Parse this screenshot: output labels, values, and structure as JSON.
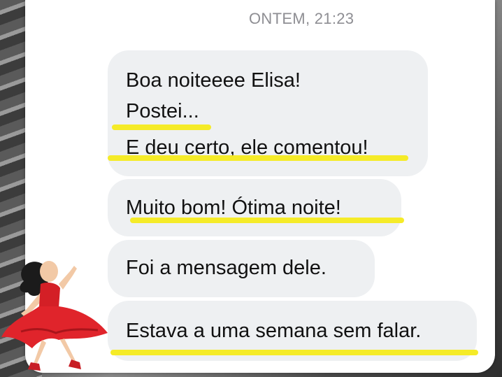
{
  "chat": {
    "timestamp": "ONTEM, 21:23",
    "messages": [
      {
        "lines": [
          "Boa noiteeee Elisa!",
          "Postei...",
          "E deu certo, ele comentou!"
        ]
      },
      {
        "lines": [
          "Muito bom! Ótima noite!"
        ]
      },
      {
        "lines": [
          "Foi a mensagem dele."
        ]
      },
      {
        "lines": [
          "Estava a uma semana sem falar."
        ]
      }
    ]
  },
  "colors": {
    "bubble": "#eef0f2",
    "highlight": "#f4ea1c",
    "timestamp": "#8e8e93"
  },
  "sticker": {
    "icon": "dancer-emoji"
  }
}
